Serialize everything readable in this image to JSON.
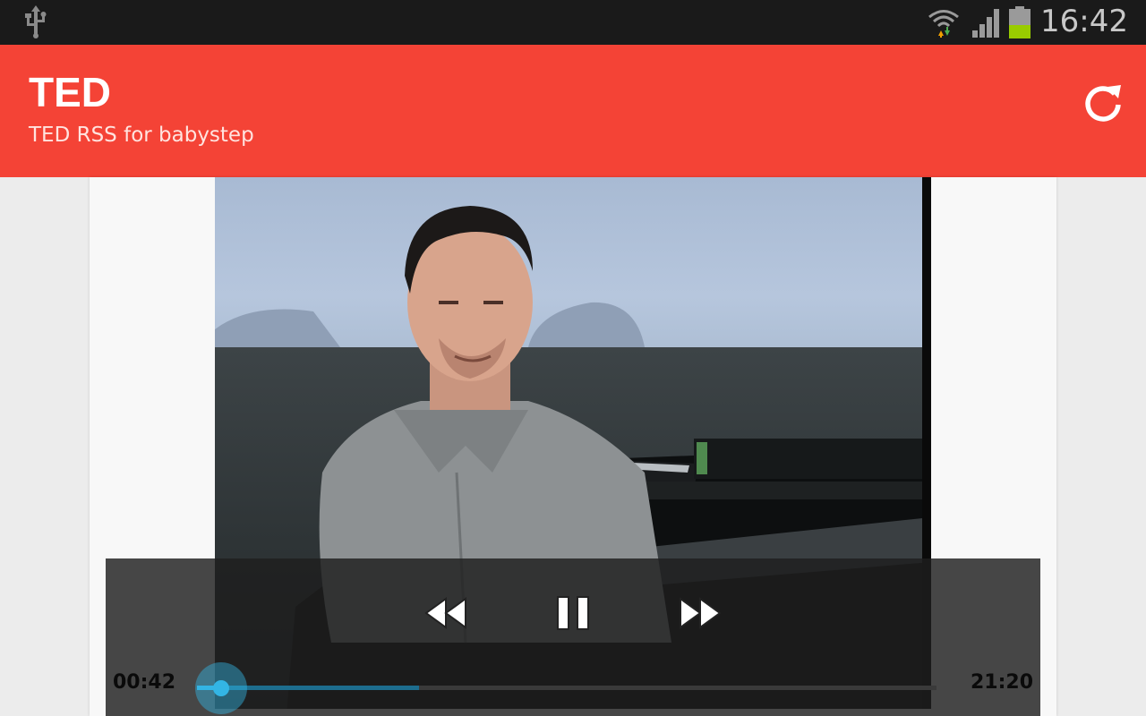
{
  "status_bar": {
    "time": "16:42",
    "icons": [
      "usb-icon",
      "wifi-icon",
      "signal-icon",
      "battery-icon"
    ],
    "battery_level": 0.45
  },
  "action_bar": {
    "title": "TED",
    "subtitle": "TED RSS for babystep",
    "refresh_icon": "refresh-icon",
    "color": "#f44336"
  },
  "video": {
    "content": "speaker-seated-at-piano"
  },
  "controller": {
    "current_time": "00:42",
    "total_time": "21:20",
    "progress": 0.033,
    "buffered": 0.3,
    "buttons": [
      "rewind-icon",
      "pause-icon",
      "fast-forward-icon"
    ],
    "accent": "#33b5e5"
  }
}
